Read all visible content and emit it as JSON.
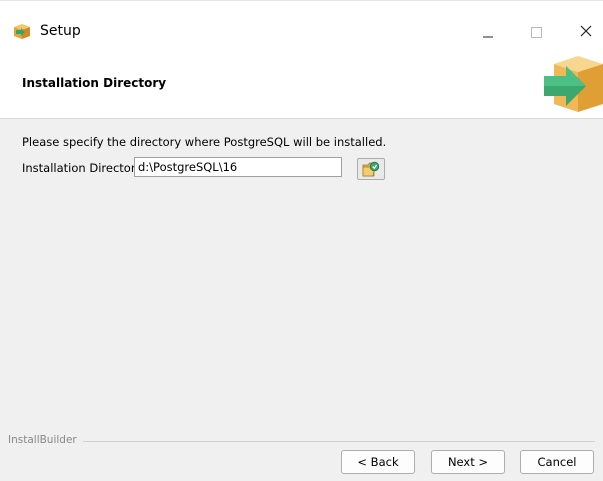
{
  "window": {
    "title": "Setup",
    "controls": {
      "minimize": "–",
      "maximize": "☐",
      "close": "✕"
    }
  },
  "header": {
    "title": "Installation Directory",
    "graphic": "installer-arrow-box-icon"
  },
  "content": {
    "prompt": "Please specify the directory where PostgreSQL will be installed.",
    "directory_label": "Installation Directory",
    "directory_value": "d:\\PostgreSQL\\16",
    "browse_icon": "folder-browse-icon"
  },
  "footer": {
    "brand": "InstallBuilder",
    "back_label": "< Back",
    "next_label": "Next >",
    "cancel_label": "Cancel"
  }
}
